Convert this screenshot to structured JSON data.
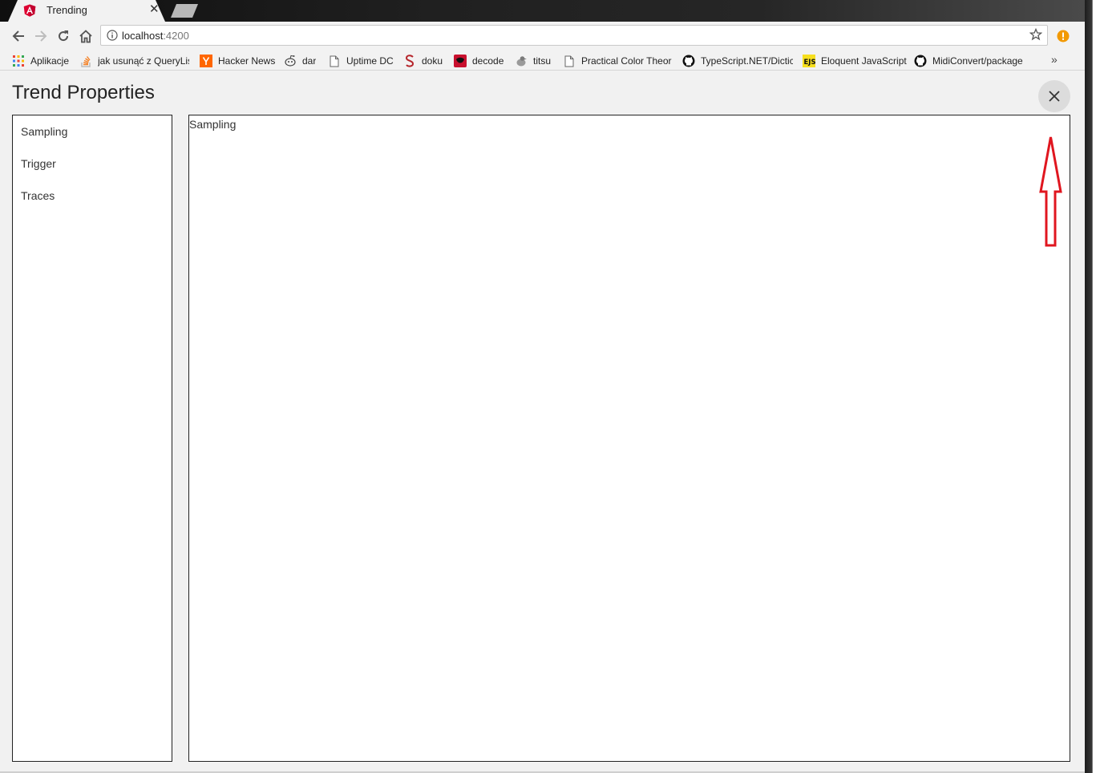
{
  "browser": {
    "tab": {
      "title": "Trending"
    },
    "address": {
      "host": "localhost",
      "port": ":4200"
    },
    "bookmarks": [
      {
        "label": "Aplikacje",
        "icon": "apps-grid-icon"
      },
      {
        "label": "jak usunąć z QueryLis",
        "icon": "stackoverflow-icon"
      },
      {
        "label": "Hacker News",
        "icon": "hacker-news-icon"
      },
      {
        "label": "dar",
        "icon": "reddit-icon"
      },
      {
        "label": "Uptime DC",
        "icon": "page-icon"
      },
      {
        "label": "doku",
        "icon": "scribd-icon"
      },
      {
        "label": "decode",
        "icon": "decode-icon"
      },
      {
        "label": "titsu",
        "icon": "bird-icon"
      },
      {
        "label": "Practical Color Theor",
        "icon": "page-icon"
      },
      {
        "label": "TypeScript.NET/Dictic",
        "icon": "github-icon"
      },
      {
        "label": "Eloquent JavaScript",
        "icon": "ejs-icon"
      },
      {
        "label": "MidiConvert/package",
        "icon": "github-icon"
      }
    ],
    "more_bookmarks": "»"
  },
  "page": {
    "title": "Trend Properties",
    "nav": [
      {
        "label": "Sampling"
      },
      {
        "label": "Trigger"
      },
      {
        "label": "Traces"
      }
    ],
    "content_heading": "Sampling"
  },
  "colors": {
    "annotation_arrow": "#e0161f",
    "angular_red": "#dd0031",
    "warning_orange": "#f29900"
  }
}
